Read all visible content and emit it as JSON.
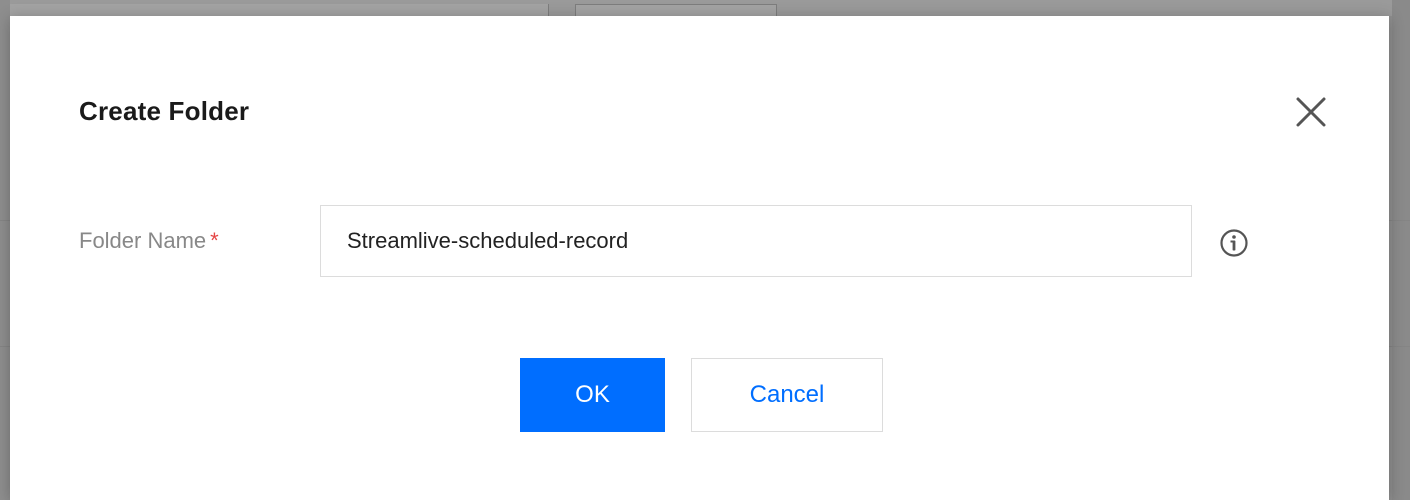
{
  "dialog": {
    "title": "Create Folder",
    "close_icon": "close-icon"
  },
  "form": {
    "folder_name": {
      "label": "Folder Name",
      "required_marker": "*",
      "value": "Streamlive-scheduled-record",
      "info_icon": "info-icon"
    }
  },
  "actions": {
    "ok_label": "OK",
    "cancel_label": "Cancel"
  },
  "colors": {
    "primary": "#006eff",
    "required": "#e54545",
    "label": "#888888",
    "title": "#1a1a1a",
    "border": "#dcdcdc",
    "overlay": "#8c8c8c"
  }
}
